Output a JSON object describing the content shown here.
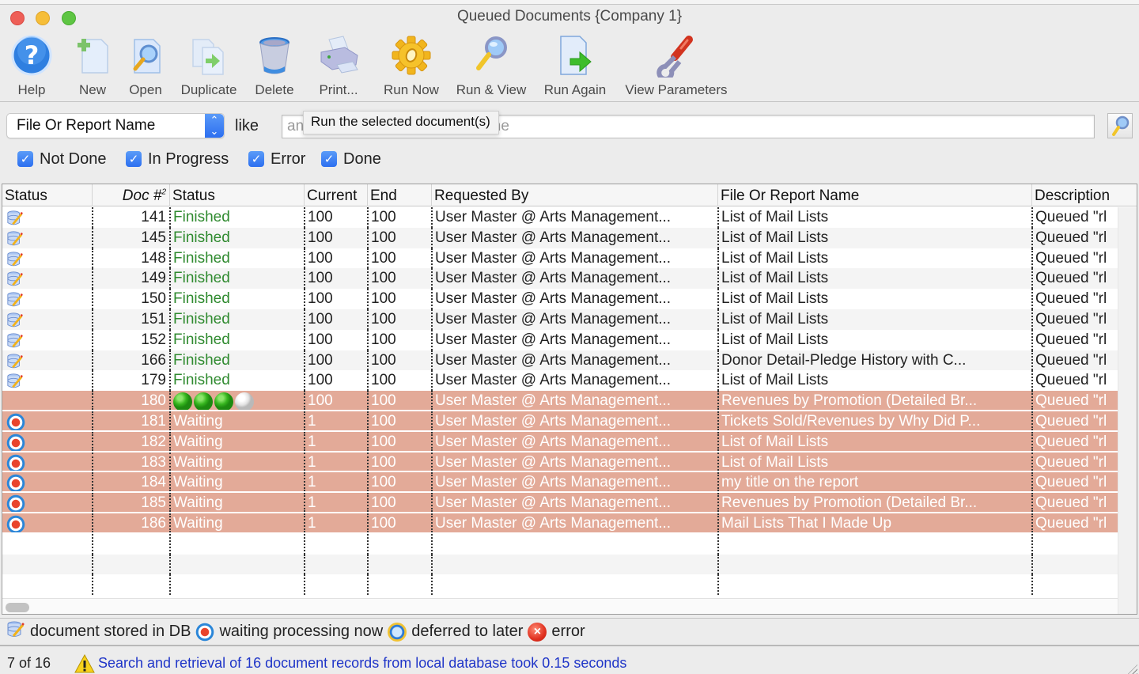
{
  "window": {
    "title": "Queued Documents {Company 1}"
  },
  "toolbar": {
    "buttons": [
      {
        "id": "help",
        "label": "Help",
        "icon": "help-icon"
      },
      {
        "id": "new",
        "label": "New",
        "icon": "new-document-icon"
      },
      {
        "id": "open",
        "label": "Open",
        "icon": "open-document-icon"
      },
      {
        "id": "duplicate",
        "label": "Duplicate",
        "icon": "duplicate-icon"
      },
      {
        "id": "delete",
        "label": "Delete",
        "icon": "trash-icon"
      },
      {
        "id": "print",
        "label": "Print...",
        "icon": "printer-icon"
      },
      {
        "id": "run-now",
        "label": "Run Now",
        "icon": "gear-icon"
      },
      {
        "id": "run-view",
        "label": "Run & View",
        "icon": "magnifier-icon"
      },
      {
        "id": "run-again",
        "label": "Run Again",
        "icon": "run-again-icon"
      },
      {
        "id": "view-params",
        "label": "View Parameters",
        "icon": "wrench-icon"
      }
    ]
  },
  "tooltip": "Run the selected document(s)",
  "filter": {
    "field_select": "File Or Report Name",
    "operator_label": "like",
    "search_placeholder": "any part of the file or report name",
    "search_value": ""
  },
  "checkboxes": [
    {
      "label": "Not Done",
      "checked": true
    },
    {
      "label": "In Progress",
      "checked": true
    },
    {
      "label": "Error",
      "checked": true
    },
    {
      "label": "Done",
      "checked": true
    }
  ],
  "table": {
    "columns": [
      {
        "key": "status_icon",
        "label": "Status"
      },
      {
        "key": "doc",
        "label": "Doc #",
        "sort_indicator": "2"
      },
      {
        "key": "status",
        "label": "Status"
      },
      {
        "key": "current",
        "label": "Current"
      },
      {
        "key": "end",
        "label": "End"
      },
      {
        "key": "requested_by",
        "label": "Requested By"
      },
      {
        "key": "file",
        "label": "File Or Report Name"
      },
      {
        "key": "description",
        "label": "Description"
      }
    ],
    "rows": [
      {
        "icon": "db",
        "doc": "141",
        "status": "Finished",
        "current": "100",
        "end": "100",
        "requested_by": "User Master @ Arts Management...",
        "file": "List of Mail Lists",
        "description": "Queued \"rl",
        "selected": false
      },
      {
        "icon": "db",
        "doc": "145",
        "status": "Finished",
        "current": "100",
        "end": "100",
        "requested_by": "User Master @ Arts Management...",
        "file": "List of Mail Lists",
        "description": "Queued \"rl",
        "selected": false
      },
      {
        "icon": "db",
        "doc": "148",
        "status": "Finished",
        "current": "100",
        "end": "100",
        "requested_by": "User Master @ Arts Management...",
        "file": "List of Mail Lists",
        "description": "Queued \"rl",
        "selected": false
      },
      {
        "icon": "db",
        "doc": "149",
        "status": "Finished",
        "current": "100",
        "end": "100",
        "requested_by": "User Master @ Arts Management...",
        "file": "List of Mail Lists",
        "description": "Queued \"rl",
        "selected": false
      },
      {
        "icon": "db",
        "doc": "150",
        "status": "Finished",
        "current": "100",
        "end": "100",
        "requested_by": "User Master @ Arts Management...",
        "file": "List of Mail Lists",
        "description": "Queued \"rl",
        "selected": false
      },
      {
        "icon": "db",
        "doc": "151",
        "status": "Finished",
        "current": "100",
        "end": "100",
        "requested_by": "User Master @ Arts Management...",
        "file": "List of Mail Lists",
        "description": "Queued \"rl",
        "selected": false
      },
      {
        "icon": "db",
        "doc": "152",
        "status": "Finished",
        "current": "100",
        "end": "100",
        "requested_by": "User Master @ Arts Management...",
        "file": "List of Mail Lists",
        "description": "Queued \"rl",
        "selected": false
      },
      {
        "icon": "db",
        "doc": "166",
        "status": "Finished",
        "current": "100",
        "end": "100",
        "requested_by": "User Master @ Arts Management...",
        "file": "Donor Detail-Pledge History with C...",
        "description": "Queued \"rl",
        "selected": false
      },
      {
        "icon": "db",
        "doc": "179",
        "status": "Finished",
        "current": "100",
        "end": "100",
        "requested_by": "User Master @ Arts Management...",
        "file": "List of Mail Lists",
        "description": "Queued \"rl",
        "selected": false
      },
      {
        "icon": "none",
        "doc": "180",
        "status": "progress",
        "progress_steps_done": 3,
        "progress_steps_total": 4,
        "current": "100",
        "end": "100",
        "requested_by": "User Master @ Arts Management...",
        "file": "Revenues by Promotion (Detailed Br...",
        "description": "Queued \"rl",
        "selected": true
      },
      {
        "icon": "wait",
        "doc": "181",
        "status": "Waiting",
        "current": "1",
        "end": "100",
        "requested_by": "User Master @ Arts Management...",
        "file": "Tickets Sold/Revenues by Why Did P...",
        "description": "Queued \"rl",
        "selected": true
      },
      {
        "icon": "wait",
        "doc": "182",
        "status": "Waiting",
        "current": "1",
        "end": "100",
        "requested_by": "User Master @ Arts Management...",
        "file": "List of Mail Lists",
        "description": "Queued \"rl",
        "selected": true
      },
      {
        "icon": "wait",
        "doc": "183",
        "status": "Waiting",
        "current": "1",
        "end": "100",
        "requested_by": "User Master @ Arts Management...",
        "file": "List of Mail Lists",
        "description": "Queued \"rl",
        "selected": true
      },
      {
        "icon": "wait",
        "doc": "184",
        "status": "Waiting",
        "current": "1",
        "end": "100",
        "requested_by": "User Master @ Arts Management...",
        "file": "my title on the report",
        "description": "Queued \"rl",
        "selected": true
      },
      {
        "icon": "wait",
        "doc": "185",
        "status": "Waiting",
        "current": "1",
        "end": "100",
        "requested_by": "User Master @ Arts Management...",
        "file": "Revenues by Promotion (Detailed Br...",
        "description": "Queued \"rl",
        "selected": true
      },
      {
        "icon": "wait",
        "doc": "186",
        "status": "Waiting",
        "current": "1",
        "end": "100",
        "requested_by": "User Master @ Arts Management...",
        "file": "Mail Lists That I Made Up",
        "description": "Queued \"rl",
        "selected": true
      }
    ],
    "empty_rows": 3
  },
  "legend": [
    {
      "icon": "db",
      "label": "document stored in DB"
    },
    {
      "icon": "wait",
      "label": "waiting processing now"
    },
    {
      "icon": "clock",
      "label": "deferred to later"
    },
    {
      "icon": "error",
      "label": "error"
    }
  ],
  "status_bar": {
    "count": "7 of 16",
    "message": "Search and retrieval of 16 document records from local database took 0.15 seconds"
  },
  "colors": {
    "selected_row": "#e3aa98",
    "finished_text": "#2f8a2f",
    "status_message": "#1f35c8",
    "accent_blue": "#2c6ff0"
  }
}
